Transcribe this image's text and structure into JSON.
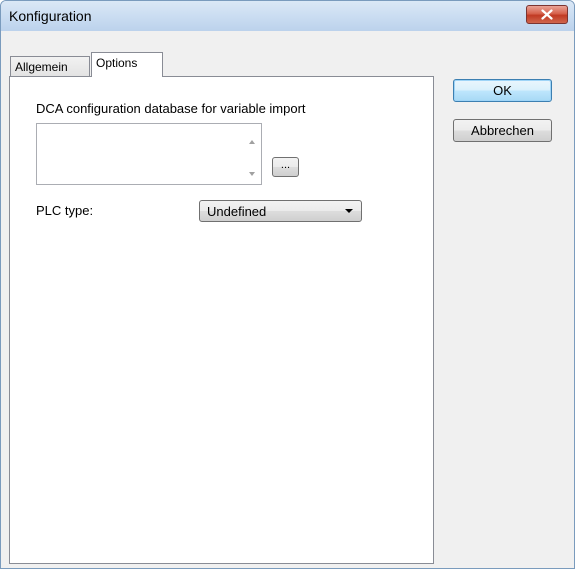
{
  "window": {
    "title": "Konfiguration"
  },
  "tabs": [
    {
      "label": "Allgemein",
      "selected": false
    },
    {
      "label": "Options",
      "selected": true
    }
  ],
  "options": {
    "dca_label": "DCA configuration database for variable import",
    "dca_value": "",
    "browse_label": "...",
    "plc_label": "PLC type:",
    "plc_value": "Undefined"
  },
  "buttons": {
    "ok_label": "OK",
    "cancel_label": "Abbrechen"
  },
  "colors": {
    "titlebar": "#c9dcf1",
    "close_button": "#c13a24",
    "default_button_border": "#3c7fb1"
  }
}
